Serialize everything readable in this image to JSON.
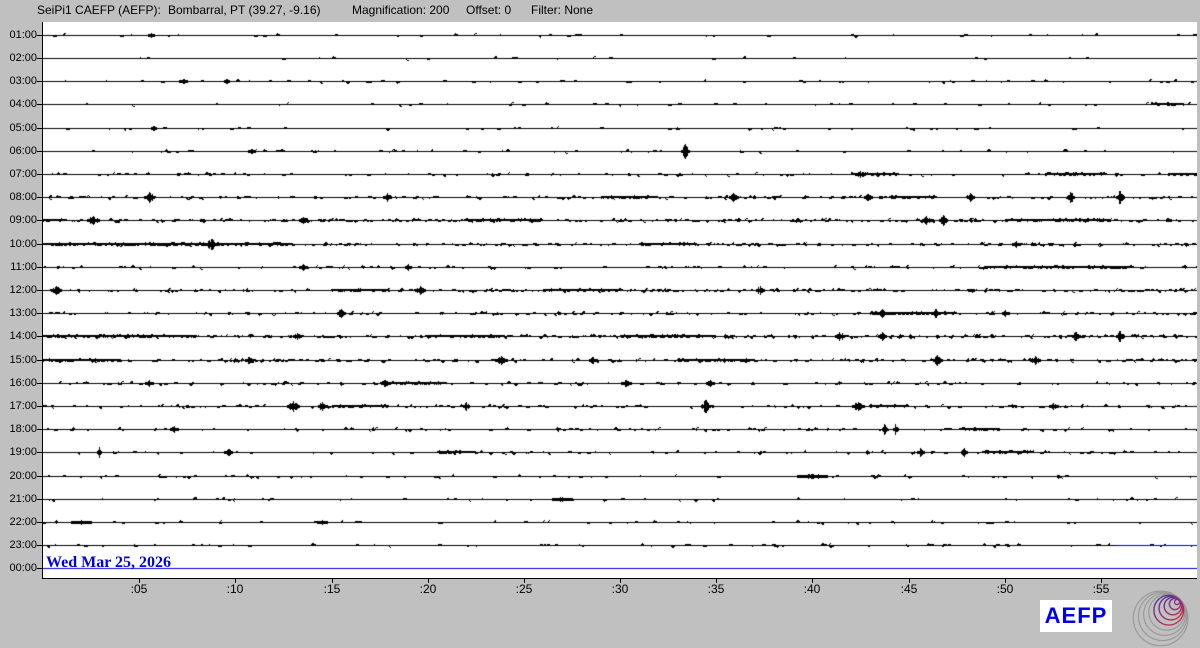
{
  "header": {
    "station": "SeiPi1 CAEFP (AEFP):",
    "location": "Bombarral, PT (39.27, -9.16)",
    "magnification": "Magnification: 200",
    "offset": "Offset: 0",
    "filter": "Filter: None"
  },
  "date_label": "Wed Mar 25, 2026",
  "logo": {
    "text": "AEFP"
  },
  "colors": {
    "background": "#c0c0c0",
    "plot_background": "#ffffff",
    "trace": "#000000",
    "accent_blue": "#0000dd",
    "logo_blue": "#0000ee",
    "spiral_gray": "#9a9a9a",
    "spiral_gradient_start": "#3c3c9c",
    "spiral_gradient_mid": "#8c3080",
    "spiral_gradient_end": "#c83440"
  },
  "chart_data": {
    "type": "helicorder",
    "title": "24-hour seismogram, one row per hour, 60 minutes per row",
    "minutes_per_row": 60,
    "x_tick_labels": [
      ":05",
      ":10",
      ":15",
      ":20",
      ":25",
      ":30",
      ":35",
      ":40",
      ":45",
      ":50",
      ":55"
    ],
    "x_tick_minutes": [
      5,
      10,
      15,
      20,
      25,
      30,
      35,
      40,
      45,
      50,
      55
    ],
    "row_labels": [
      "01:00",
      "02:00",
      "03:00",
      "04:00",
      "05:00",
      "06:00",
      "07:00",
      "08:00",
      "09:00",
      "10:00",
      "11:00",
      "12:00",
      "13:00",
      "14:00",
      "15:00",
      "16:00",
      "17:00",
      "18:00",
      "19:00",
      "20:00",
      "21:00",
      "22:00",
      "23:00",
      "00:00"
    ],
    "rows": [
      {
        "label": "01:00",
        "noise": 0.02,
        "bursts": [
          [
            5.6,
            2,
            6
          ]
        ],
        "dark": []
      },
      {
        "label": "02:00",
        "noise": 0.012,
        "bursts": [],
        "dark": []
      },
      {
        "label": "03:00",
        "noise": 0.03,
        "bursts": [
          [
            7.3,
            2,
            8
          ],
          [
            9.5,
            2,
            5
          ]
        ],
        "dark": []
      },
      {
        "label": "04:00",
        "noise": 0.022,
        "bursts": [],
        "dark": [
          [
            57.6,
            59.3
          ]
        ]
      },
      {
        "label": "05:00",
        "noise": 0.025,
        "bursts": [
          [
            5.7,
            2,
            5
          ]
        ],
        "dark": []
      },
      {
        "label": "06:00",
        "noise": 0.03,
        "bursts": [
          [
            10.8,
            2,
            6
          ],
          [
            33.4,
            7,
            8
          ]
        ],
        "dark": []
      },
      {
        "label": "07:00",
        "noise": 0.055,
        "bursts": [
          [
            42.5,
            3,
            10
          ]
        ],
        "dark": [
          [
            42.0,
            44.5
          ],
          [
            52.1,
            55.2
          ],
          [
            58.5,
            60.0
          ]
        ]
      },
      {
        "label": "08:00",
        "noise": 0.1,
        "bursts": [
          [
            5.5,
            5,
            10
          ],
          [
            17.9,
            4,
            8
          ],
          [
            35.9,
            4,
            9
          ],
          [
            42.9,
            3,
            8
          ],
          [
            48.2,
            4,
            7
          ],
          [
            53.4,
            5,
            7
          ],
          [
            56.0,
            6,
            8
          ]
        ],
        "dark": [
          [
            29.0,
            32.0
          ],
          [
            44.0,
            46.5
          ]
        ]
      },
      {
        "label": "09:00",
        "noise": 0.15,
        "bursts": [
          [
            2.6,
            4,
            12
          ],
          [
            13.5,
            3,
            8
          ],
          [
            45.9,
            4,
            9
          ],
          [
            46.8,
            5,
            8
          ]
        ],
        "dark": [
          [
            0.0,
            1.2
          ],
          [
            22.0,
            26.0
          ],
          [
            50.0,
            55.5
          ]
        ]
      },
      {
        "label": "10:00",
        "noise": 0.12,
        "bursts": [
          [
            8.75,
            5,
            12
          ],
          [
            50.6,
            3,
            8
          ]
        ],
        "dark": [
          [
            0.0,
            13.0
          ],
          [
            31.0,
            34.0
          ]
        ]
      },
      {
        "label": "11:00",
        "noise": 0.06,
        "bursts": [
          [
            13.5,
            3,
            8
          ],
          [
            19.0,
            3,
            6
          ]
        ],
        "dark": [
          [
            48.9,
            56.7
          ]
        ]
      },
      {
        "label": "12:00",
        "noise": 0.13,
        "bursts": [
          [
            0.7,
            4,
            10
          ],
          [
            19.6,
            4,
            10
          ],
          [
            37.3,
            4,
            8
          ]
        ],
        "dark": [
          [
            15.0,
            18.0
          ],
          [
            26.0,
            30.0
          ]
        ]
      },
      {
        "label": "13:00",
        "noise": 0.09,
        "bursts": [
          [
            15.5,
            4,
            8
          ],
          [
            43.6,
            4,
            9
          ],
          [
            46.4,
            4,
            8
          ],
          [
            50.0,
            3,
            7
          ]
        ],
        "dark": [
          [
            43.0,
            47.5
          ]
        ]
      },
      {
        "label": "14:00",
        "noise": 0.16,
        "bursts": [
          [
            13.2,
            3,
            8
          ],
          [
            41.4,
            4,
            9
          ],
          [
            43.6,
            4,
            8
          ],
          [
            53.7,
            4,
            8
          ],
          [
            56.0,
            5,
            8
          ]
        ],
        "dark": [
          [
            0.0,
            8.0
          ],
          [
            20.0,
            24.0
          ],
          [
            30.0,
            35.0
          ]
        ]
      },
      {
        "label": "15:00",
        "noise": 0.13,
        "bursts": [
          [
            10.7,
            3,
            8
          ],
          [
            23.8,
            4,
            12
          ],
          [
            28.6,
            3,
            8
          ],
          [
            46.5,
            5,
            9
          ],
          [
            51.6,
            4,
            10
          ]
        ],
        "dark": [
          [
            0.0,
            4.0
          ],
          [
            33.0,
            37.0
          ]
        ]
      },
      {
        "label": "16:00",
        "noise": 0.07,
        "bursts": [
          [
            5.5,
            3,
            8
          ],
          [
            17.8,
            3,
            9
          ],
          [
            30.3,
            3,
            10
          ],
          [
            34.7,
            3,
            8
          ]
        ],
        "dark": [
          [
            17.5,
            21.0
          ]
        ]
      },
      {
        "label": "17:00",
        "noise": 0.08,
        "bursts": [
          [
            13.0,
            5,
            12
          ],
          [
            14.5,
            4,
            8
          ],
          [
            22.0,
            4,
            6
          ],
          [
            34.4,
            6,
            9
          ],
          [
            42.4,
            4,
            12
          ],
          [
            52.5,
            3,
            9
          ]
        ],
        "dark": [
          [
            15.0,
            18.0
          ],
          [
            43.0,
            45.0
          ]
        ]
      },
      {
        "label": "18:00",
        "noise": 0.06,
        "bursts": [
          [
            6.8,
            3,
            8
          ],
          [
            43.75,
            5,
            5
          ],
          [
            44.3,
            5,
            5
          ]
        ],
        "dark": [
          [
            47.6,
            49.7
          ]
        ]
      },
      {
        "label": "19:00",
        "noise": 0.05,
        "bursts": [
          [
            2.9,
            5,
            4
          ],
          [
            9.6,
            3,
            8
          ],
          [
            45.6,
            4,
            7
          ],
          [
            47.9,
            4,
            6
          ]
        ],
        "dark": [
          [
            20.5,
            22.5
          ],
          [
            49.0,
            51.5
          ]
        ]
      },
      {
        "label": "20:00",
        "noise": 0.035,
        "bursts": [
          [
            40.0,
            2,
            30
          ]
        ],
        "dark": []
      },
      {
        "label": "21:00",
        "noise": 0.03,
        "bursts": [
          [
            27.0,
            2,
            20
          ]
        ],
        "dark": []
      },
      {
        "label": "22:00",
        "noise": 0.03,
        "bursts": [
          [
            2.0,
            2,
            20
          ],
          [
            14.5,
            2,
            10
          ]
        ],
        "dark": []
      },
      {
        "label": "23:00",
        "noise": 0.04,
        "bursts": [],
        "dark": [],
        "blue_tail_minute": 55.9
      },
      {
        "label": "00:00",
        "noise": 0,
        "bursts": [],
        "dark": [],
        "blue_line": true
      }
    ]
  }
}
